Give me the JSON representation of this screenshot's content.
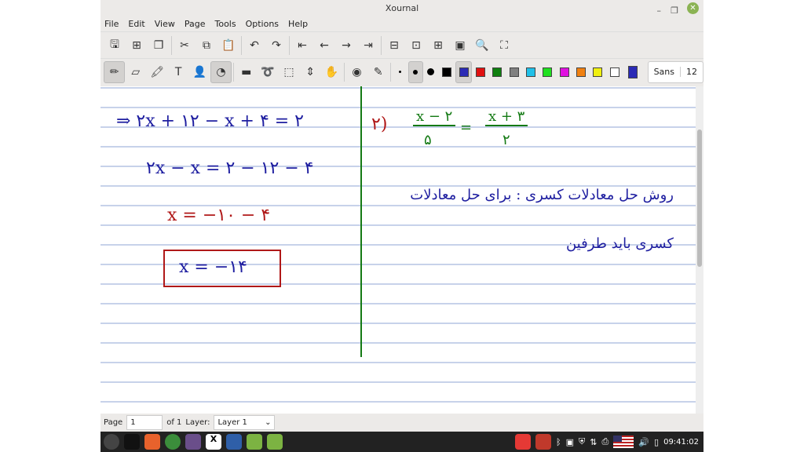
{
  "window": {
    "title": "Xournal"
  },
  "menu": [
    "File",
    "Edit",
    "View",
    "Page",
    "Tools",
    "Options",
    "Help"
  ],
  "toolbar1": [
    {
      "name": "save",
      "g": "🖫"
    },
    {
      "name": "new-page",
      "g": "⊞"
    },
    {
      "name": "duplicate",
      "g": "❐"
    },
    {
      "name": "cut",
      "g": "✂"
    },
    {
      "name": "copy",
      "g": "⧉"
    },
    {
      "name": "paste",
      "g": "📋"
    },
    {
      "name": "undo",
      "g": "↶"
    },
    {
      "name": "redo",
      "g": "↷"
    },
    {
      "name": "first-page",
      "g": "⇤"
    },
    {
      "name": "prev-page",
      "g": "←"
    },
    {
      "name": "next-page",
      "g": "→"
    },
    {
      "name": "last-page",
      "g": "⇥"
    },
    {
      "name": "zoom-out",
      "g": "⊟"
    },
    {
      "name": "zoom-fit",
      "g": "⊡"
    },
    {
      "name": "zoom-in",
      "g": "⊞"
    },
    {
      "name": "zoom-100",
      "g": "▣"
    },
    {
      "name": "find",
      "g": "🔍"
    },
    {
      "name": "fullscreen",
      "g": "⛶"
    }
  ],
  "toolbar2": [
    {
      "name": "pen",
      "g": "✏",
      "on": true
    },
    {
      "name": "eraser",
      "g": "▱"
    },
    {
      "name": "highlighter",
      "g": "🖍"
    },
    {
      "name": "text",
      "g": "T"
    },
    {
      "name": "image",
      "g": "👤"
    },
    {
      "name": "shape-recognizer",
      "g": "◔",
      "on": true
    },
    {
      "name": "ruler",
      "g": "▬"
    },
    {
      "name": "lasso",
      "g": "➰"
    },
    {
      "name": "rect-select",
      "g": "⬚"
    },
    {
      "name": "vertical-space",
      "g": "⇕"
    },
    {
      "name": "hand",
      "g": "✋"
    },
    {
      "name": "default-tool",
      "g": "◉"
    },
    {
      "name": "default-pen",
      "g": "✎"
    }
  ],
  "thickness": [
    "fine",
    "medium",
    "thick"
  ],
  "colors": [
    "#000000",
    "#2a2ab5",
    "#e01010",
    "#108010",
    "#808080",
    "#20c0e8",
    "#20e020",
    "#e010e0",
    "#f08010",
    "#f0f010",
    "#ffffff"
  ],
  "selected_color": "#2a2ab5",
  "font": {
    "name": "Sans",
    "size": "12"
  },
  "notes": {
    "left": [
      "⇒ ۲x + ۱۲ − x + ۴ = ۲",
      "۲x − x = ۲ − ۱۲ − ۴",
      "x = −۱۰ − ۴",
      "x = −۱۴"
    ],
    "right_eq": [
      "۲)",
      "x − ۲",
      "۵",
      "=",
      "x + ۳",
      "۲"
    ],
    "right_text": [
      "روش حل معادلات کسری : برای حل معادلات",
      "کسری باید طرفین"
    ]
  },
  "status": {
    "page_label": "Page",
    "page_value": "1",
    "of": "of 1",
    "layer_label": "Layer:",
    "layer_value": "Layer 1"
  },
  "taskbar": {
    "clock": "09:41:02"
  }
}
